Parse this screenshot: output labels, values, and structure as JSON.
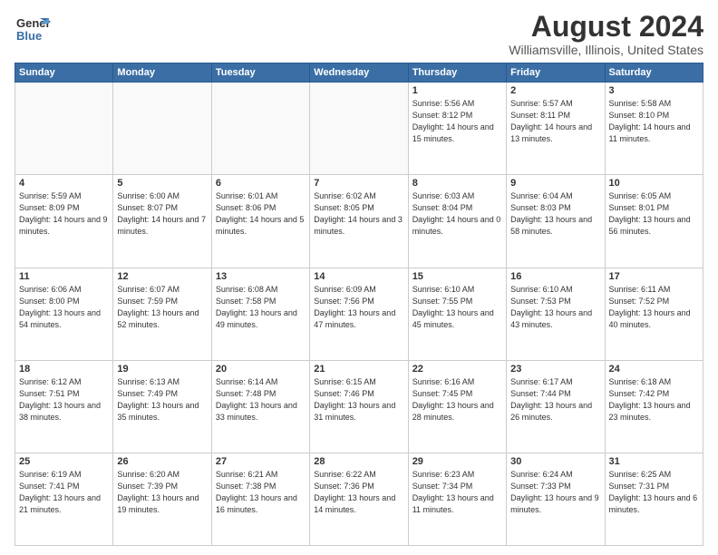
{
  "header": {
    "logo_general": "General",
    "logo_blue": "Blue",
    "main_title": "August 2024",
    "subtitle": "Williamsville, Illinois, United States"
  },
  "weekdays": [
    "Sunday",
    "Monday",
    "Tuesday",
    "Wednesday",
    "Thursday",
    "Friday",
    "Saturday"
  ],
  "weeks": [
    [
      {
        "day": "",
        "info": ""
      },
      {
        "day": "",
        "info": ""
      },
      {
        "day": "",
        "info": ""
      },
      {
        "day": "",
        "info": ""
      },
      {
        "day": "1",
        "info": "Sunrise: 5:56 AM\nSunset: 8:12 PM\nDaylight: 14 hours\nand 15 minutes."
      },
      {
        "day": "2",
        "info": "Sunrise: 5:57 AM\nSunset: 8:11 PM\nDaylight: 14 hours\nand 13 minutes."
      },
      {
        "day": "3",
        "info": "Sunrise: 5:58 AM\nSunset: 8:10 PM\nDaylight: 14 hours\nand 11 minutes."
      }
    ],
    [
      {
        "day": "4",
        "info": "Sunrise: 5:59 AM\nSunset: 8:09 PM\nDaylight: 14 hours\nand 9 minutes."
      },
      {
        "day": "5",
        "info": "Sunrise: 6:00 AM\nSunset: 8:07 PM\nDaylight: 14 hours\nand 7 minutes."
      },
      {
        "day": "6",
        "info": "Sunrise: 6:01 AM\nSunset: 8:06 PM\nDaylight: 14 hours\nand 5 minutes."
      },
      {
        "day": "7",
        "info": "Sunrise: 6:02 AM\nSunset: 8:05 PM\nDaylight: 14 hours\nand 3 minutes."
      },
      {
        "day": "8",
        "info": "Sunrise: 6:03 AM\nSunset: 8:04 PM\nDaylight: 14 hours\nand 0 minutes."
      },
      {
        "day": "9",
        "info": "Sunrise: 6:04 AM\nSunset: 8:03 PM\nDaylight: 13 hours\nand 58 minutes."
      },
      {
        "day": "10",
        "info": "Sunrise: 6:05 AM\nSunset: 8:01 PM\nDaylight: 13 hours\nand 56 minutes."
      }
    ],
    [
      {
        "day": "11",
        "info": "Sunrise: 6:06 AM\nSunset: 8:00 PM\nDaylight: 13 hours\nand 54 minutes."
      },
      {
        "day": "12",
        "info": "Sunrise: 6:07 AM\nSunset: 7:59 PM\nDaylight: 13 hours\nand 52 minutes."
      },
      {
        "day": "13",
        "info": "Sunrise: 6:08 AM\nSunset: 7:58 PM\nDaylight: 13 hours\nand 49 minutes."
      },
      {
        "day": "14",
        "info": "Sunrise: 6:09 AM\nSunset: 7:56 PM\nDaylight: 13 hours\nand 47 minutes."
      },
      {
        "day": "15",
        "info": "Sunrise: 6:10 AM\nSunset: 7:55 PM\nDaylight: 13 hours\nand 45 minutes."
      },
      {
        "day": "16",
        "info": "Sunrise: 6:10 AM\nSunset: 7:53 PM\nDaylight: 13 hours\nand 43 minutes."
      },
      {
        "day": "17",
        "info": "Sunrise: 6:11 AM\nSunset: 7:52 PM\nDaylight: 13 hours\nand 40 minutes."
      }
    ],
    [
      {
        "day": "18",
        "info": "Sunrise: 6:12 AM\nSunset: 7:51 PM\nDaylight: 13 hours\nand 38 minutes."
      },
      {
        "day": "19",
        "info": "Sunrise: 6:13 AM\nSunset: 7:49 PM\nDaylight: 13 hours\nand 35 minutes."
      },
      {
        "day": "20",
        "info": "Sunrise: 6:14 AM\nSunset: 7:48 PM\nDaylight: 13 hours\nand 33 minutes."
      },
      {
        "day": "21",
        "info": "Sunrise: 6:15 AM\nSunset: 7:46 PM\nDaylight: 13 hours\nand 31 minutes."
      },
      {
        "day": "22",
        "info": "Sunrise: 6:16 AM\nSunset: 7:45 PM\nDaylight: 13 hours\nand 28 minutes."
      },
      {
        "day": "23",
        "info": "Sunrise: 6:17 AM\nSunset: 7:44 PM\nDaylight: 13 hours\nand 26 minutes."
      },
      {
        "day": "24",
        "info": "Sunrise: 6:18 AM\nSunset: 7:42 PM\nDaylight: 13 hours\nand 23 minutes."
      }
    ],
    [
      {
        "day": "25",
        "info": "Sunrise: 6:19 AM\nSunset: 7:41 PM\nDaylight: 13 hours\nand 21 minutes."
      },
      {
        "day": "26",
        "info": "Sunrise: 6:20 AM\nSunset: 7:39 PM\nDaylight: 13 hours\nand 19 minutes."
      },
      {
        "day": "27",
        "info": "Sunrise: 6:21 AM\nSunset: 7:38 PM\nDaylight: 13 hours\nand 16 minutes."
      },
      {
        "day": "28",
        "info": "Sunrise: 6:22 AM\nSunset: 7:36 PM\nDaylight: 13 hours\nand 14 minutes."
      },
      {
        "day": "29",
        "info": "Sunrise: 6:23 AM\nSunset: 7:34 PM\nDaylight: 13 hours\nand 11 minutes."
      },
      {
        "day": "30",
        "info": "Sunrise: 6:24 AM\nSunset: 7:33 PM\nDaylight: 13 hours\nand 9 minutes."
      },
      {
        "day": "31",
        "info": "Sunrise: 6:25 AM\nSunset: 7:31 PM\nDaylight: 13 hours\nand 6 minutes."
      }
    ]
  ]
}
